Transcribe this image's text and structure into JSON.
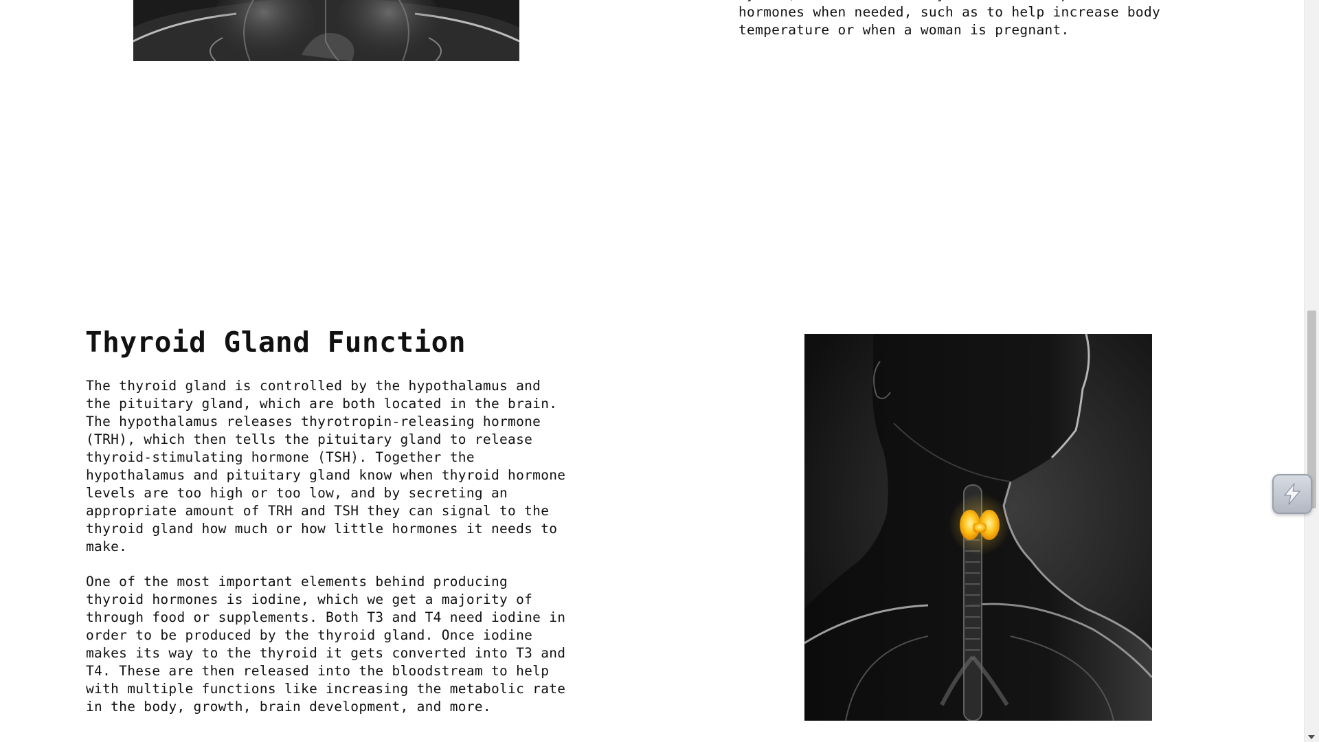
{
  "top_paragraph": {
    "text": "cycles, and more. The thyroid can also produce more\nhormones when needed, such as to help increase body\ntemperature or when a woman is pregnant."
  },
  "section": {
    "title": "Thyroid Gland Function",
    "paragraph_1": "The thyroid gland is controlled by the hypothalamus and\nthe pituitary gland, which are both located in the brain.\nThe hypothalamus releases thyrotropin-releasing hormone\n(TRH), which then tells the pituitary gland to release\nthyroid-stimulating hormone (TSH). Together the\nhypothalamus and pituitary gland know when thyroid hormone\nlevels are too high or too low, and by secreting an\nappropriate amount of TRH and TSH they can signal to the\nthyroid gland how much or how little hormones it needs to\nmake.",
    "paragraph_2": "One of the most important elements behind producing\nthyroid hormones is iodine, which we get a majority of\nthrough food or supplements. Both T3 and T4 need iodine in\norder to be produced by the thyroid gland. Once iodine\nmakes its way to the thyroid it gets converted into T3 and\nT4. These are then released into the bloodstream to help\nwith multiple functions like increasing the metabolic rate\nin the body, growth, brain development, and more."
  },
  "images": {
    "top_image_icon": "xray-torso-image",
    "thyroid_image_icon": "thyroid-anatomy-image",
    "thyroid_highlight_color": "#ffc21a"
  },
  "widget": {
    "icon": "lightning-bolt-icon"
  }
}
